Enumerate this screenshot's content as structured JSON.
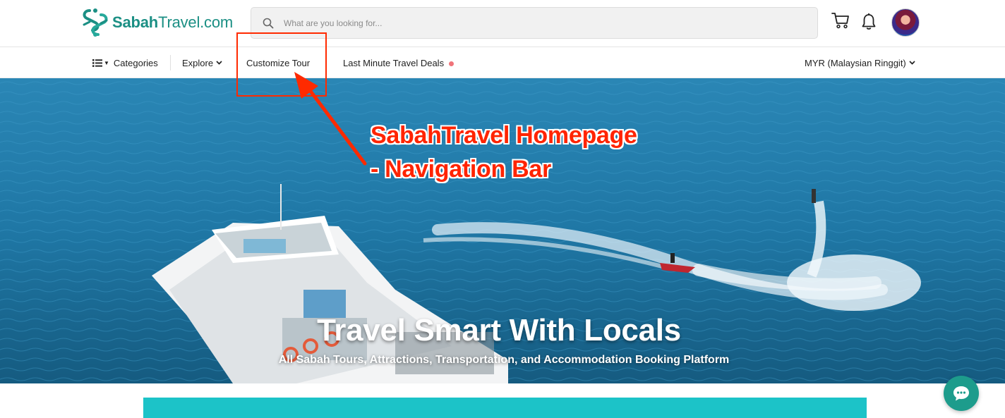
{
  "header": {
    "logo_text_bold": "Sabah",
    "logo_text_rest": "Travel.com",
    "search_placeholder": "What are you looking for..."
  },
  "nav": {
    "categories": "Categories",
    "explore": "Explore",
    "customize_tour": "Customize Tour",
    "last_minute_deals": "Last Minute Travel Deals",
    "currency": "MYR (Malaysian Ringgit)"
  },
  "hero": {
    "title": "Travel Smart With Locals",
    "subtitle": "All Sabah Tours, Attractions, Transportation, and Accommodation Booking Platform"
  },
  "annotation": {
    "line1": "SabahTravel Homepage",
    "line2": "- Navigation Bar"
  },
  "colors": {
    "brand": "#1b8f84",
    "annotation": "#ff2a00",
    "teal_bar": "#1cc3c8",
    "chat": "#1d9c8c"
  },
  "icons": [
    "logo-mark-icon",
    "search-icon",
    "cart-icon",
    "bell-icon",
    "list-icon",
    "chevron-down-icon",
    "chat-icon"
  ]
}
